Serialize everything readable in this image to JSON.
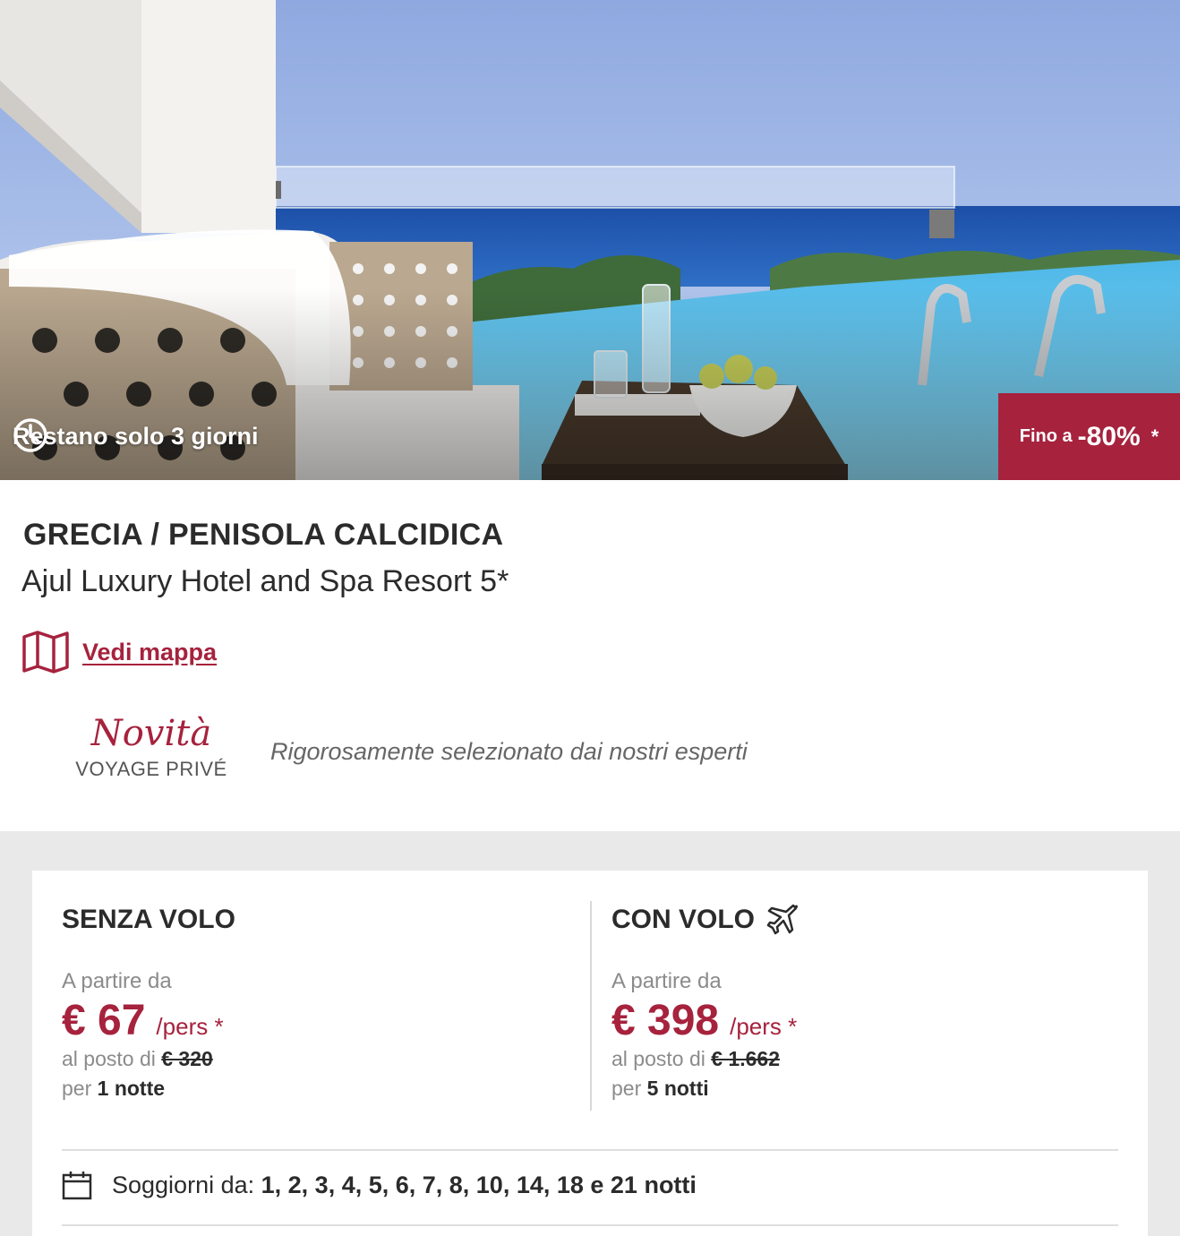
{
  "hero": {
    "timer_text": "Restano solo 3 giorni",
    "discount_prefix": "Fino a",
    "discount_value": "-80%",
    "discount_note": "*"
  },
  "info": {
    "location": "GRECIA / PENISOLA CALCIDICA",
    "hotel_name": "Ajul Luxury Hotel and Spa Resort 5*",
    "map_link": "Vedi mappa",
    "novita_title": "Novità",
    "novita_brand": "VOYAGE PRIVÉ",
    "novita_desc": "Rigorosamente selezionato dai nostri esperti"
  },
  "offers": [
    {
      "title": "SENZA VOLO",
      "from_label": "A partire da",
      "price": "€ 67",
      "per_label": "/pers *",
      "was_label": "al posto di",
      "was_price": "€ 320",
      "per_word": "per",
      "nights": "1 notte"
    },
    {
      "title": "CON VOLO",
      "from_label": "A partire da",
      "price": "€ 398",
      "per_label": "/pers *",
      "was_label": "al posto di",
      "was_price": "€ 1.662",
      "per_word": "per",
      "nights": "5 notti"
    }
  ],
  "stays": {
    "label": "Soggiorni da:",
    "values": "1, 2, 3, 4, 5, 6, 7, 8, 10, 14, 18 e 21 notti"
  },
  "icons": {
    "timer": "clock-icon",
    "map": "map-icon",
    "plane": "airplane-icon",
    "calendar": "calendar-icon"
  },
  "colors": {
    "accent": "#a6223d",
    "muted": "#8b8b8b",
    "panel_bg": "#e9e9e9"
  }
}
